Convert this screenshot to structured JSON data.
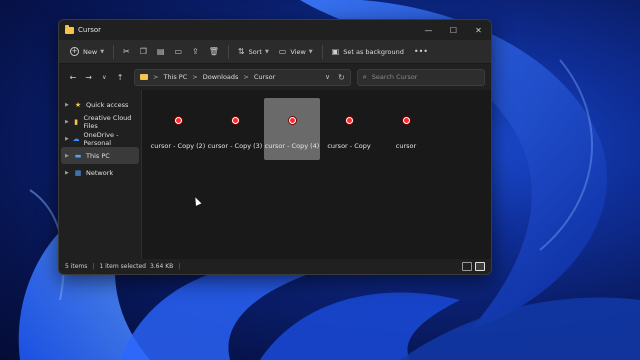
{
  "window": {
    "title": "Cursor"
  },
  "window_controls": {
    "minimize": "—",
    "maximize": "☐",
    "close": "✕"
  },
  "toolbar": {
    "new_label": "New",
    "sort_label": "Sort",
    "view_label": "View",
    "set_bg_label": "Set as background",
    "more_label": "•••"
  },
  "address": {
    "crumbs": [
      "This PC",
      "Downloads",
      "Cursor"
    ],
    "separator": ">"
  },
  "search": {
    "placeholder": "Search Cursor"
  },
  "sidebar": {
    "items": [
      {
        "label": "Quick access",
        "icon": "star-icon"
      },
      {
        "label": "Creative Cloud Files",
        "icon": "document-icon"
      },
      {
        "label": "OneDrive - Personal",
        "icon": "cloud-icon"
      },
      {
        "label": "This PC",
        "icon": "computer-icon",
        "selected": true
      },
      {
        "label": "Network",
        "icon": "network-icon"
      }
    ]
  },
  "files": [
    {
      "name": "cursor - Copy (2)"
    },
    {
      "name": "cursor - Copy (3)"
    },
    {
      "name": "cursor - Copy (4)",
      "selected": true
    },
    {
      "name": "cursor - Copy"
    },
    {
      "name": "cursor"
    }
  ],
  "status": {
    "items": "5 items",
    "selected": "1 item selected",
    "size": "3.64 KB"
  },
  "colors": {
    "accent_folder": "#f4c54a",
    "cursor_red": "#ff2a2a",
    "selection": "#6a6a6a"
  }
}
